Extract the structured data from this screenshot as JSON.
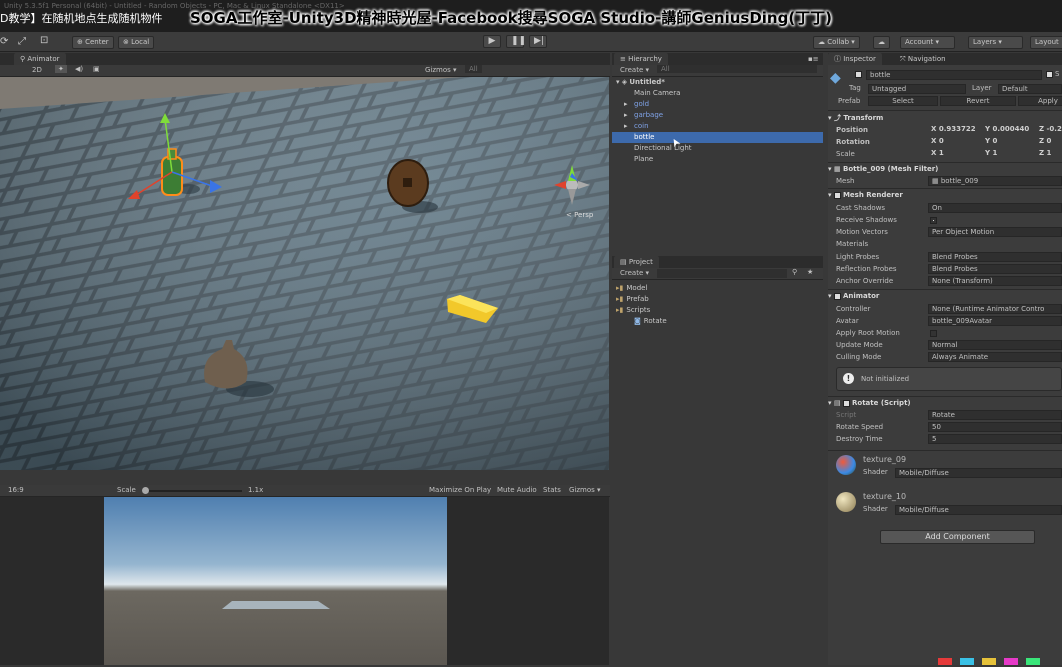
{
  "titlebar": {
    "bg_text": "Unity 5.3.5f1 Personal (64bit) - Untitled - Random Objects - PC, Mac & Linux Standalone <DX11>",
    "course": "D教学】在随机地点生成随机物件",
    "soga": "SOGA工作室-Unity3D精神時光屋-Facebook搜尋SOGA Studio-講師GeniusDing(丁丁)"
  },
  "toolbar": {
    "center": "Center",
    "local": "Local",
    "collab": "Collab ▾",
    "account": "Account ▾",
    "layers": "Layers ▾",
    "layout": "Layout"
  },
  "scene": {
    "tab": "Animator",
    "mode": "2D",
    "gizmos": "Gizmos ▾",
    "all": "All",
    "persp": "< Persp"
  },
  "game": {
    "aspect": "16:9",
    "scale_label": "Scale",
    "scale_value": "1.1x",
    "maximize": "Maximize On Play",
    "mute": "Mute Audio",
    "stats": "Stats",
    "gizmos": "Gizmos ▾"
  },
  "hierarchy": {
    "tab": "Hierarchy",
    "create": "Create ▾",
    "search": "All",
    "scene_name": "Untitled*",
    "items": [
      {
        "label": "Main Camera",
        "indent": 1,
        "color": "#c8c8c8"
      },
      {
        "label": "gold",
        "indent": 1,
        "color": "#7fa2e6",
        "arrow": true
      },
      {
        "label": "garbage",
        "indent": 1,
        "color": "#7fa2e6",
        "arrow": true
      },
      {
        "label": "coin",
        "indent": 1,
        "color": "#7fa2e6",
        "arrow": true
      },
      {
        "label": "bottle",
        "indent": 1,
        "color": "#ffffff",
        "selected": true
      },
      {
        "label": "Directional Light",
        "indent": 1,
        "color": "#c8c8c8"
      },
      {
        "label": "Plane",
        "indent": 1,
        "color": "#c8c8c8"
      }
    ]
  },
  "project": {
    "tab": "Project",
    "create": "Create ▾",
    "items": [
      {
        "label": "Model",
        "folder": true
      },
      {
        "label": "Prefab",
        "folder": true
      },
      {
        "label": "Scripts",
        "folder": true
      },
      {
        "label": "Rotate",
        "indent": 2
      }
    ]
  },
  "inspector": {
    "tab": "Inspector",
    "nav_tab": "Navigation",
    "name": "bottle",
    "static": "S",
    "tag_label": "Tag",
    "tag": "Untagged",
    "layer_label": "Layer",
    "layer": "Default",
    "prefab_label": "Prefab",
    "select": "Select",
    "revert": "Revert",
    "apply": "Apply",
    "transform": {
      "title": "Transform",
      "position": "Position",
      "rotation": "Rotation",
      "scale": "Scale",
      "px": "X 0.933722",
      "py": "Y 0.000440",
      "pz": "Z -0.2",
      "rx": "X 0",
      "ry": "Y 0",
      "rz": "Z 0",
      "sx": "X 1",
      "sy": "Y 1",
      "sz": "Z 1"
    },
    "mesh_filter": {
      "title": "Bottle_009 (Mesh Filter)",
      "mesh_label": "Mesh",
      "mesh": "bottle_009"
    },
    "mesh_renderer": {
      "title": "Mesh Renderer",
      "cast": "Cast Shadows",
      "cast_val": "On",
      "receive": "Receive Shadows",
      "motion": "Motion Vectors",
      "motion_val": "Per Object Motion",
      "materials": "Materials",
      "light": "Light Probes",
      "light_val": "Blend Probes",
      "reflection": "Reflection Probes",
      "reflection_val": "Blend Probes",
      "anchor": "Anchor Override",
      "anchor_val": "None (Transform)"
    },
    "animator": {
      "title": "Animator",
      "controller": "Controller",
      "controller_val": "None (Runtime Animator Contro",
      "avatar": "Avatar",
      "avatar_val": "bottle_009Avatar",
      "root": "Apply Root Motion",
      "update": "Update Mode",
      "update_val": "Normal",
      "culling": "Culling Mode",
      "culling_val": "Always Animate",
      "note": "Not initialized"
    },
    "rotate": {
      "title": "Rotate (Script)",
      "script": "Script",
      "script_val": "Rotate",
      "speed": "Rotate Speed",
      "speed_val": "50",
      "destroy": "Destroy Time",
      "destroy_val": "5"
    },
    "materials": [
      {
        "name": "texture_09",
        "shader": "Mobile/Diffuse"
      },
      {
        "name": "texture_10",
        "shader": "Mobile/Diffuse"
      }
    ],
    "shader_label": "Shader",
    "add_component": "Add Component"
  },
  "colors": {
    "accent": "#3d6aac",
    "panel": "#383838",
    "selected": "#3d6aac"
  }
}
